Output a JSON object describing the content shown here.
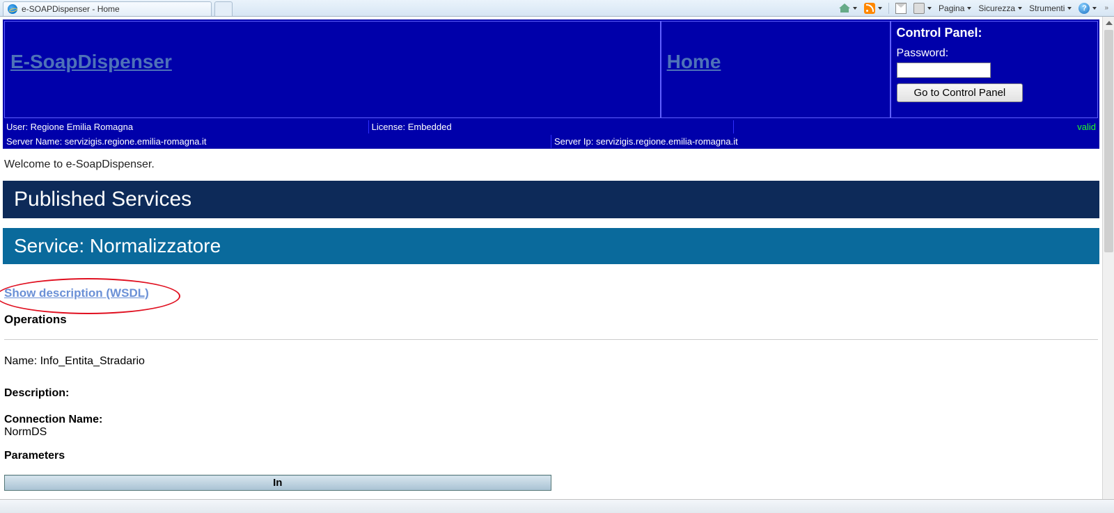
{
  "browser": {
    "tab_title": "e-SOAPDispenser - Home",
    "menu": {
      "pagina": "Pagina",
      "sicurezza": "Sicurezza",
      "strumenti": "Strumenti"
    },
    "help_glyph": "?"
  },
  "header": {
    "brand": "E-SoapDispenser",
    "home": "Home",
    "control_panel_title": "Control Panel:",
    "password_label": "Password:",
    "goto_button": "Go to Control Panel"
  },
  "info": {
    "user": "User: Regione Emilia Romagna",
    "license": "License: Embedded",
    "valid": "valid",
    "server_name": "Server Name: servizigis.regione.emilia-romagna.it",
    "server_ip": "Server Ip: servizigis.regione.emilia-romagna.it"
  },
  "body": {
    "welcome": "Welcome to e-SoapDispenser.",
    "published_services": "Published Services",
    "service_title": "Service: Normalizzatore",
    "wsdl_link": "Show description (WSDL)",
    "operations_heading": "Operations",
    "name_label": "Name",
    "name_value": "Info_Entita_Stradario",
    "description_label": "Description:",
    "conn_label": "Connection Name:",
    "conn_value": "NormDS",
    "params_label": "Parameters",
    "in_header": "In"
  }
}
